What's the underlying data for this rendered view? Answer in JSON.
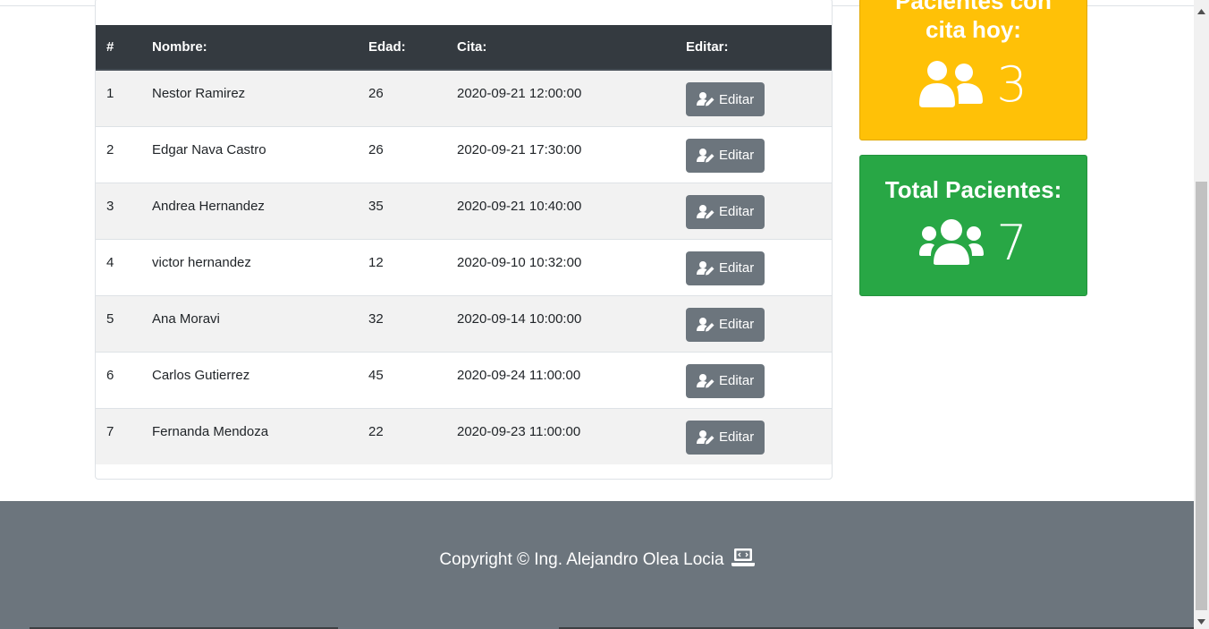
{
  "table": {
    "headers": [
      "#",
      "Nombre:",
      "Edad:",
      "Cita:",
      "Editar:"
    ],
    "rows": [
      {
        "num": "1",
        "name": "Nestor Ramirez",
        "age": "26",
        "date": "2020-09-21 12:00:00",
        "button": "Editar"
      },
      {
        "num": "2",
        "name": "Edgar Nava Castro",
        "age": "26",
        "date": "2020-09-21 17:30:00",
        "button": "Editar"
      },
      {
        "num": "3",
        "name": "Andrea Hernandez",
        "age": "35",
        "date": "2020-09-21 10:40:00",
        "button": "Editar"
      },
      {
        "num": "4",
        "name": "victor hernandez",
        "age": "12",
        "date": "2020-09-10 10:32:00",
        "button": "Editar"
      },
      {
        "num": "5",
        "name": "Ana Moravi",
        "age": "32",
        "date": "2020-09-14 10:00:00",
        "button": "Editar"
      },
      {
        "num": "6",
        "name": "Carlos Gutierrez",
        "age": "45",
        "date": "2020-09-24 11:00:00",
        "button": "Editar"
      },
      {
        "num": "7",
        "name": "Fernanda Mendoza",
        "age": "22",
        "date": "2020-09-23 11:00:00",
        "button": "Editar"
      }
    ]
  },
  "stats": {
    "today": {
      "title_line1": "Pacientes con",
      "title_line2": "cita hoy:",
      "value": "3",
      "icon": "users-icon",
      "color": "#ffc107"
    },
    "total": {
      "title": "Total Pacientes:",
      "value": "7",
      "icon": "users-icon",
      "color": "#28a745"
    }
  },
  "footer": {
    "text": "Copyright © Ing. Alejandro Olea Locia",
    "icon": "laptop-code-icon"
  },
  "colors": {
    "table_header": "#343a40",
    "button": "#6c757d",
    "footer": "#6c757d"
  }
}
